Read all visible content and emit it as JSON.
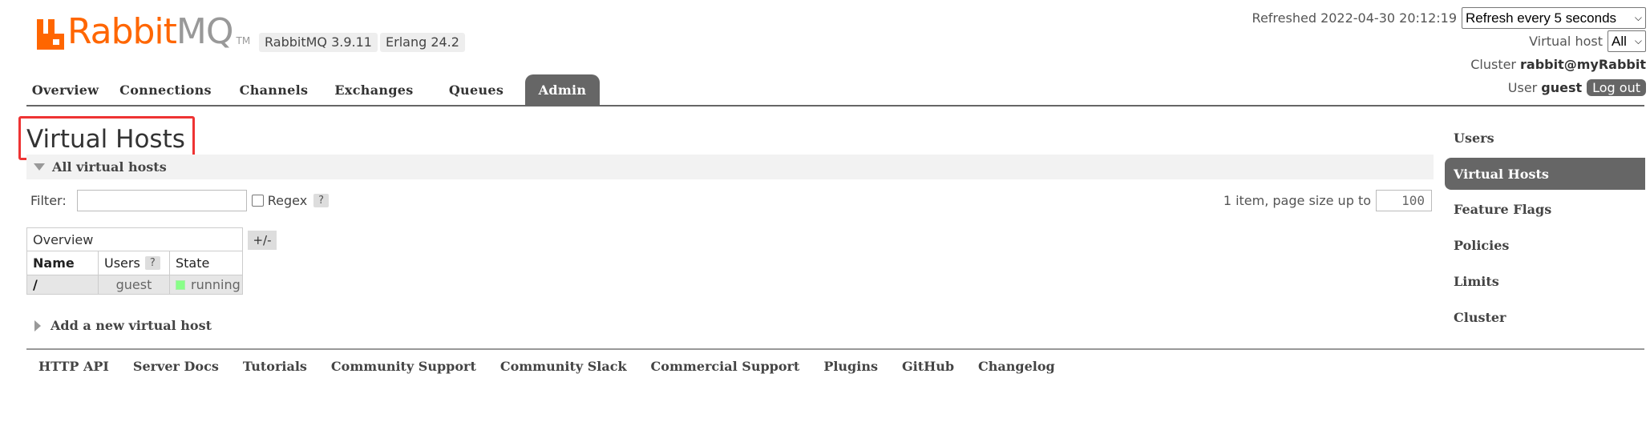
{
  "header": {
    "logo_text_a": "Rabbit",
    "logo_text_b": "MQ",
    "logo_tm": "TM",
    "version": "RabbitMQ 3.9.11",
    "erlang": "Erlang 24.2",
    "refreshed_label": "Refreshed",
    "refreshed_time": "2022-04-30 20:12:19",
    "refresh_select": "Refresh every 5 seconds",
    "vhost_label": "Virtual host",
    "vhost_select": "All",
    "cluster_label": "Cluster",
    "cluster_name": "rabbit@myRabbit",
    "user_label": "User",
    "user_name": "guest",
    "logout": "Log out"
  },
  "tabs": [
    "Overview",
    "Connections",
    "Channels",
    "Exchanges",
    "Queues",
    "Admin"
  ],
  "active_tab": "Admin",
  "right_nav": [
    "Users",
    "Virtual Hosts",
    "Feature Flags",
    "Policies",
    "Limits",
    "Cluster"
  ],
  "active_right_nav": "Virtual Hosts",
  "page_title": "Virtual Hosts",
  "section_all": "All virtual hosts",
  "filter": {
    "label": "Filter:",
    "value": "",
    "regex_label": "Regex",
    "help": "?",
    "paging_text": "1 item, page size up to",
    "page_size": "100"
  },
  "table": {
    "group_header": "Overview",
    "toggle": "+/-",
    "columns": [
      "Name",
      "Users",
      "State"
    ],
    "users_help": "?",
    "rows": [
      {
        "name": "/",
        "users": "guest",
        "state": "running"
      }
    ]
  },
  "section_add": "Add a new virtual host",
  "footer_links": [
    "HTTP API",
    "Server Docs",
    "Tutorials",
    "Community Support",
    "Community Slack",
    "Commercial Support",
    "Plugins",
    "GitHub",
    "Changelog"
  ],
  "colors": {
    "brand": "#ff6600",
    "active_tab": "#666666",
    "running": "#88ff88",
    "highlight": "#ee3333"
  }
}
